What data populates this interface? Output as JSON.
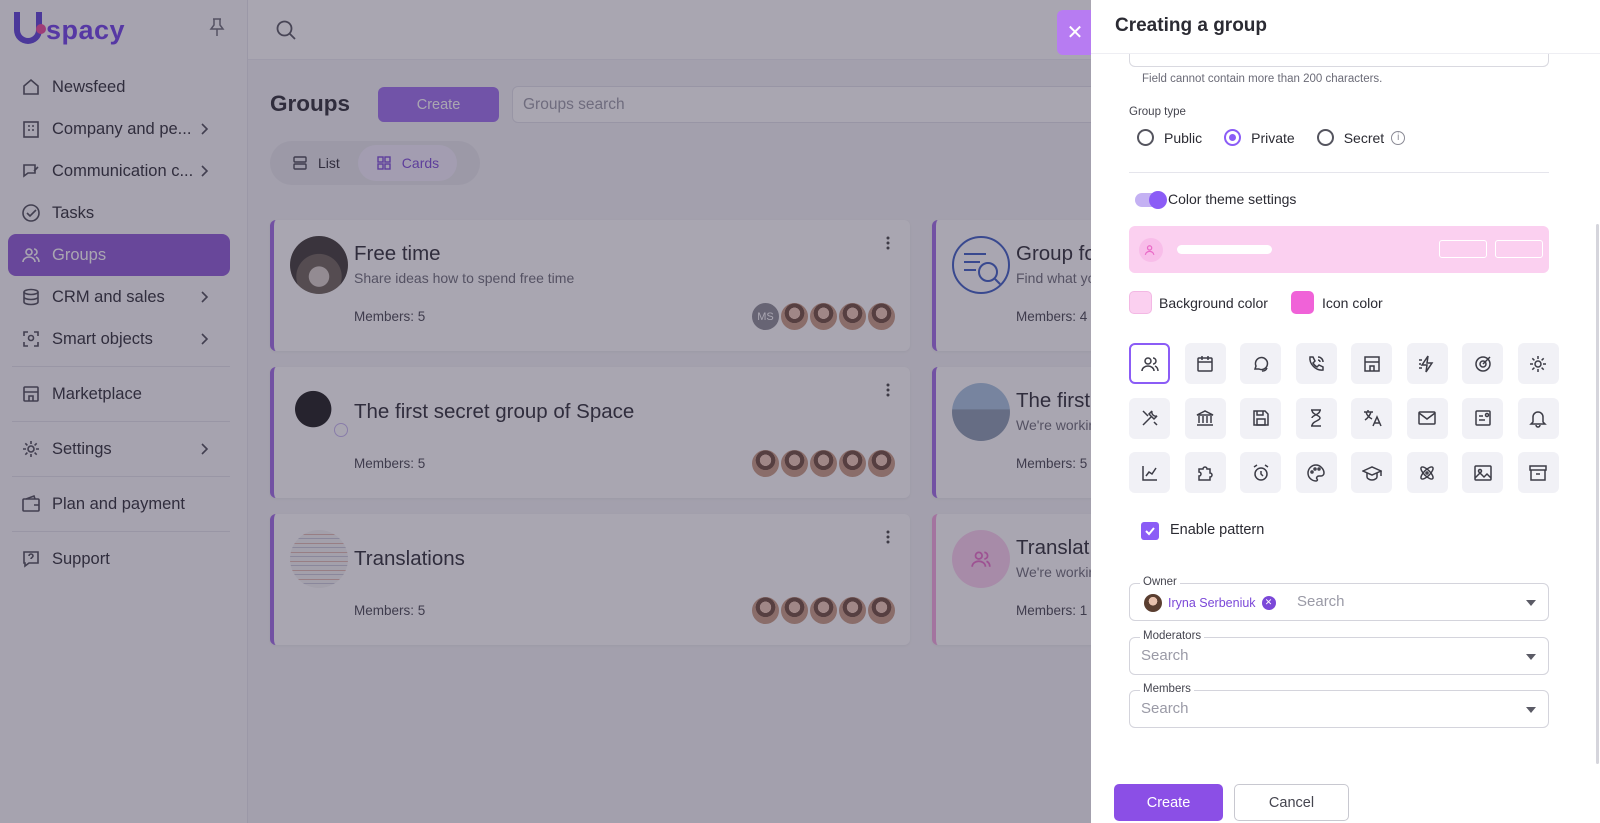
{
  "brand": {
    "name": "spacy"
  },
  "sidebar": {
    "items": [
      {
        "label": "Newsfeed"
      },
      {
        "label": "Company and pe..."
      },
      {
        "label": "Communication c..."
      },
      {
        "label": "Tasks"
      },
      {
        "label": "Groups"
      },
      {
        "label": "CRM and sales"
      },
      {
        "label": "Smart objects"
      },
      {
        "label": "Marketplace"
      },
      {
        "label": "Settings"
      },
      {
        "label": "Plan and payment"
      },
      {
        "label": "Support"
      }
    ]
  },
  "main": {
    "title": "Groups",
    "create_label": "Create",
    "search_placeholder": "Groups search",
    "views": {
      "list": "List",
      "cards": "Cards"
    },
    "cards": [
      {
        "title": "Free time",
        "desc": "Share ideas how to spend free time",
        "members": "Members: 5",
        "initials": "MS"
      },
      {
        "title": "Group fo",
        "desc": "Find what yo",
        "members": "Members: 4"
      },
      {
        "title": "The first secret group of Space",
        "desc": "",
        "members": "Members: 5"
      },
      {
        "title": "The first",
        "desc": "We're workin",
        "members": "Members: 5"
      },
      {
        "title": "Translations",
        "desc": "",
        "members": "Members: 5"
      },
      {
        "title": "Translat",
        "desc": "We're workin",
        "members": "Members: 1"
      }
    ]
  },
  "drawer": {
    "title": "Creating a group",
    "char_hint": "Field cannot contain more than 200 characters.",
    "group_type_label": "Group type",
    "group_types": [
      {
        "label": "Public",
        "selected": false
      },
      {
        "label": "Private",
        "selected": true
      },
      {
        "label": "Secret",
        "selected": false
      }
    ],
    "theme_toggle_label": "Color theme settings",
    "theme_enabled": true,
    "background_color_label": "Background color",
    "background_color": "#fbd0f0",
    "icon_color_label": "Icon color",
    "icon_color": "#f062d8",
    "icons": [
      "users-icon",
      "calendar-icon",
      "chat-icon",
      "phone-icon",
      "building-icon",
      "lightning-icon",
      "target-icon",
      "gear-icon",
      "tools-icon",
      "bank-icon",
      "save-icon",
      "hourglass-icon",
      "translate-icon",
      "mail-icon",
      "profile-card-icon",
      "bell-icon",
      "chart-icon",
      "puzzle-icon",
      "alarm-icon",
      "palette-icon",
      "graduation-icon",
      "atom-icon",
      "image-icon",
      "archive-icon"
    ],
    "enable_pattern_label": "Enable pattern",
    "enable_pattern": true,
    "owner": {
      "label": "Owner",
      "chip": "Iryna Serbeniuk",
      "placeholder": "Search"
    },
    "moderators": {
      "label": "Moderators",
      "placeholder": "Search"
    },
    "members": {
      "label": "Members",
      "placeholder": "Search"
    },
    "create_label": "Create",
    "cancel_label": "Cancel"
  },
  "colors": {
    "accent": "#8b5cf6",
    "active_nav": "#8e58d6"
  }
}
